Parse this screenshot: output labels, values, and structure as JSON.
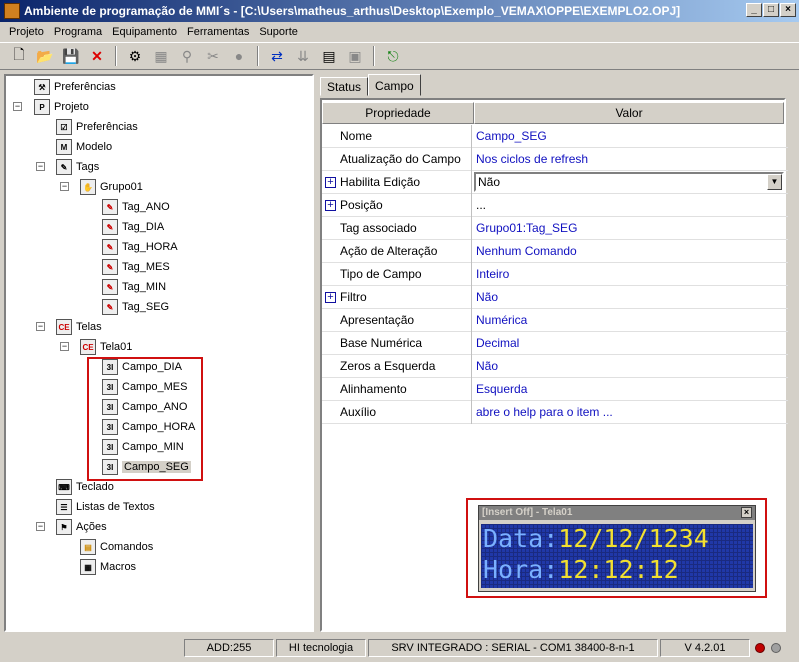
{
  "window": {
    "title": "Ambiente de programação de MMI´s - [C:\\Users\\matheus_arthus\\Desktop\\Exemplo_VEMAX\\OPPE\\EXEMPLO2.OPJ]"
  },
  "menu": [
    "Projeto",
    "Programa",
    "Equipamento",
    "Ferramentas",
    "Suporte"
  ],
  "tree": {
    "preferencias_root": "Preferências",
    "projeto": "Projeto",
    "preferencias": "Preferências",
    "modelo": "Modelo",
    "tags": "Tags",
    "grupo": "Grupo01",
    "tag_items": [
      "Tag_ANO",
      "Tag_DIA",
      "Tag_HORA",
      "Tag_MES",
      "Tag_MIN",
      "Tag_SEG"
    ],
    "telas": "Telas",
    "tela01": "Tela01",
    "campos": [
      "Campo_DIA",
      "Campo_MES",
      "Campo_ANO",
      "Campo_HORA",
      "Campo_MIN",
      "Campo_SEG"
    ],
    "teclado": "Teclado",
    "listas": "Listas de Textos",
    "acoes": "Ações",
    "comandos": "Comandos",
    "macros": "Macros"
  },
  "tabs": [
    "Status",
    "Campo"
  ],
  "grid": {
    "col_prop": "Propriedade",
    "col_val": "Valor",
    "rows": [
      {
        "name": "Nome",
        "value": "Campo_SEG"
      },
      {
        "name": "Atualização do Campo",
        "value": "Nos ciclos de refresh"
      },
      {
        "name": "Habilita Edição",
        "value": "Não"
      },
      {
        "name": "Posição",
        "value": "..."
      },
      {
        "name": "Tag associado",
        "value": "Grupo01:Tag_SEG"
      },
      {
        "name": "Ação de Alteração",
        "value": "Nenhum Comando"
      },
      {
        "name": "Tipo de Campo",
        "value": "Inteiro"
      },
      {
        "name": "Filtro",
        "value": "Não"
      },
      {
        "name": "Apresentação",
        "value": "Numérica"
      },
      {
        "name": "Base Numérica",
        "value": "Decimal"
      },
      {
        "name": "Zeros a Esquerda",
        "value": "Não"
      },
      {
        "name": "Alinhamento",
        "value": "Esquerda"
      },
      {
        "name": "Auxílio",
        "value": "abre o help para o item ..."
      }
    ]
  },
  "preview": {
    "title": "[Insert Off] - Tela01",
    "line1_label": "Data:",
    "line1_value": "12/12/1234",
    "line2_label": "Hora:",
    "line2_value": "12:12:12"
  },
  "status": {
    "addr": "ADD:255",
    "company": "HI tecnologia",
    "server": "SRV INTEGRADO : SERIAL - COM1 38400-8-n-1",
    "version": "V 4.2.01"
  },
  "colors": {
    "accent": "#0a246a",
    "highlight": "#d01010",
    "lcd_bg": "#2038a8",
    "lcd_text": "#7ab0ff",
    "lcd_value": "#f2e030"
  }
}
